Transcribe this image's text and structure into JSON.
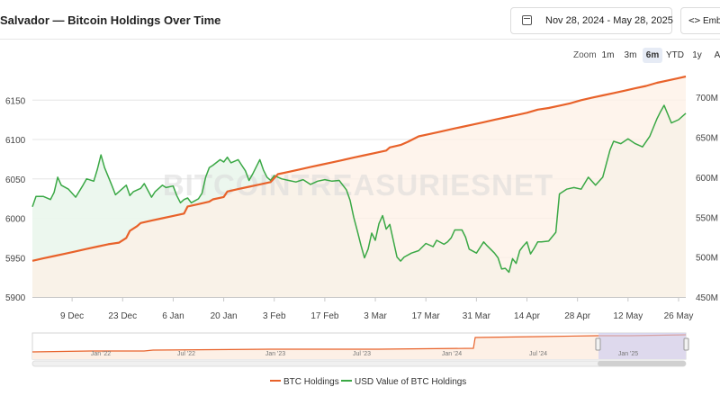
{
  "header": {
    "title": "Salvador — Bitcoin Holdings Over Time",
    "date_range": "Nov 28, 2024 - May 28, 2025",
    "embed_label": "Embe"
  },
  "zoom": {
    "label": "Zoom",
    "options": [
      "1m",
      "3m",
      "6m",
      "YTD",
      "1y",
      "A"
    ],
    "active": "6m"
  },
  "watermark": "BITCOINTREASURIESNET",
  "colors": {
    "btc": "#e8622a",
    "usd": "#3aa845",
    "btc_fill": "#fdf0e6",
    "usd_fill": "#eaf6ec",
    "navigator_mask": "#c9c9f2"
  },
  "chart_data": {
    "type": "line",
    "title": "",
    "x_range": [
      "2024-11-28",
      "2025-05-28"
    ],
    "x_ticks": [
      "9 Dec",
      "23 Dec",
      "6 Jan",
      "20 Jan",
      "3 Feb",
      "17 Feb",
      "3 Mar",
      "17 Mar",
      "31 Mar",
      "14 Apr",
      "28 Apr",
      "12 May",
      "26 May"
    ],
    "y_left": {
      "ticks": [
        "5900",
        "5950",
        "6000",
        "6050",
        "6100",
        "6150"
      ],
      "range": [
        5900,
        6188
      ]
    },
    "y_right": {
      "ticks": [
        "450M",
        "500M",
        "550M",
        "600M",
        "650M",
        "700M"
      ],
      "range": [
        450,
        734
      ]
    },
    "series": [
      {
        "name": "BTC Holdings",
        "axis": "left",
        "points": [
          [
            "2024-11-28",
            5946
          ],
          [
            "2024-12-01",
            5949
          ],
          [
            "2024-12-04",
            5952
          ],
          [
            "2024-12-07",
            5955
          ],
          [
            "2024-12-10",
            5958
          ],
          [
            "2024-12-13",
            5961
          ],
          [
            "2024-12-16",
            5964
          ],
          [
            "2024-12-19",
            5967
          ],
          [
            "2024-12-22",
            5969
          ],
          [
            "2024-12-24",
            5975
          ],
          [
            "2024-12-25",
            5984
          ],
          [
            "2024-12-27",
            5990
          ],
          [
            "2024-12-28",
            5994
          ],
          [
            "2024-12-31",
            5997
          ],
          [
            "2025-01-03",
            6000
          ],
          [
            "2025-01-06",
            6003
          ],
          [
            "2025-01-09",
            6006
          ],
          [
            "2025-01-10",
            6015
          ],
          [
            "2025-01-13",
            6018
          ],
          [
            "2025-01-16",
            6021
          ],
          [
            "2025-01-17",
            6024
          ],
          [
            "2025-01-20",
            6027
          ],
          [
            "2025-01-21",
            6034
          ],
          [
            "2025-01-24",
            6037
          ],
          [
            "2025-01-27",
            6040
          ],
          [
            "2025-01-30",
            6043
          ],
          [
            "2025-02-02",
            6046
          ],
          [
            "2025-02-04",
            6056
          ],
          [
            "2025-02-07",
            6059
          ],
          [
            "2025-02-10",
            6062
          ],
          [
            "2025-02-13",
            6065
          ],
          [
            "2025-02-16",
            6068
          ],
          [
            "2025-02-19",
            6071
          ],
          [
            "2025-02-22",
            6074
          ],
          [
            "2025-02-25",
            6077
          ],
          [
            "2025-02-28",
            6080
          ],
          [
            "2025-03-03",
            6083
          ],
          [
            "2025-03-06",
            6086
          ],
          [
            "2025-03-07",
            6090
          ],
          [
            "2025-03-10",
            6093
          ],
          [
            "2025-03-12",
            6097
          ],
          [
            "2025-03-15",
            6104
          ],
          [
            "2025-03-18",
            6107
          ],
          [
            "2025-03-21",
            6110
          ],
          [
            "2025-03-24",
            6113
          ],
          [
            "2025-03-27",
            6116
          ],
          [
            "2025-03-30",
            6119
          ],
          [
            "2025-04-02",
            6122
          ],
          [
            "2025-04-05",
            6125
          ],
          [
            "2025-04-08",
            6128
          ],
          [
            "2025-04-11",
            6131
          ],
          [
            "2025-04-14",
            6134
          ],
          [
            "2025-04-17",
            6138
          ],
          [
            "2025-04-20",
            6140
          ],
          [
            "2025-04-23",
            6143
          ],
          [
            "2025-04-26",
            6146
          ],
          [
            "2025-04-29",
            6150
          ],
          [
            "2025-05-02",
            6153
          ],
          [
            "2025-05-05",
            6156
          ],
          [
            "2025-05-08",
            6159
          ],
          [
            "2025-05-11",
            6162
          ],
          [
            "2025-05-14",
            6165
          ],
          [
            "2025-05-17",
            6168
          ],
          [
            "2025-05-20",
            6172
          ],
          [
            "2025-05-23",
            6175
          ],
          [
            "2025-05-26",
            6178
          ],
          [
            "2025-05-28",
            6180
          ]
        ]
      },
      {
        "name": "USD Value of BTC Holdings",
        "axis": "right",
        "points": [
          [
            "2024-11-28",
            563
          ],
          [
            "2024-11-29",
            576
          ],
          [
            "2024-12-01",
            576
          ],
          [
            "2024-12-03",
            572
          ],
          [
            "2024-12-04",
            581
          ],
          [
            "2024-12-05",
            600
          ],
          [
            "2024-12-06",
            590
          ],
          [
            "2024-12-08",
            585
          ],
          [
            "2024-12-10",
            575
          ],
          [
            "2024-12-12",
            590
          ],
          [
            "2024-12-13",
            598
          ],
          [
            "2024-12-15",
            595
          ],
          [
            "2024-12-16",
            610
          ],
          [
            "2024-12-17",
            628
          ],
          [
            "2024-12-18",
            612
          ],
          [
            "2024-12-20",
            590
          ],
          [
            "2024-12-21",
            578
          ],
          [
            "2024-12-23",
            586
          ],
          [
            "2024-12-24",
            590
          ],
          [
            "2024-12-25",
            577
          ],
          [
            "2024-12-26",
            582
          ],
          [
            "2024-12-28",
            586
          ],
          [
            "2024-12-29",
            592
          ],
          [
            "2024-12-31",
            575
          ],
          [
            "2025-01-01",
            582
          ],
          [
            "2025-01-03",
            590
          ],
          [
            "2025-01-04",
            587
          ],
          [
            "2025-01-06",
            589
          ],
          [
            "2025-01-07",
            577
          ],
          [
            "2025-01-08",
            568
          ],
          [
            "2025-01-09",
            572
          ],
          [
            "2025-01-10",
            574
          ],
          [
            "2025-01-11",
            568
          ],
          [
            "2025-01-13",
            573
          ],
          [
            "2025-01-14",
            580
          ],
          [
            "2025-01-15",
            600
          ],
          [
            "2025-01-16",
            612
          ],
          [
            "2025-01-17",
            615
          ],
          [
            "2025-01-19",
            622
          ],
          [
            "2025-01-20",
            619
          ],
          [
            "2025-01-21",
            625
          ],
          [
            "2025-01-22",
            618
          ],
          [
            "2025-01-23",
            620
          ],
          [
            "2025-01-24",
            622
          ],
          [
            "2025-01-25",
            615
          ],
          [
            "2025-01-26",
            608
          ],
          [
            "2025-01-27",
            596
          ],
          [
            "2025-01-28",
            604
          ],
          [
            "2025-01-30",
            622
          ],
          [
            "2025-01-31",
            609
          ],
          [
            "2025-02-01",
            600
          ],
          [
            "2025-02-02",
            596
          ],
          [
            "2025-02-03",
            602
          ],
          [
            "2025-02-05",
            598
          ],
          [
            "2025-02-07",
            596
          ],
          [
            "2025-02-09",
            594
          ],
          [
            "2025-02-11",
            597
          ],
          [
            "2025-02-13",
            591
          ],
          [
            "2025-02-15",
            595
          ],
          [
            "2025-02-17",
            597
          ],
          [
            "2025-02-19",
            595
          ],
          [
            "2025-02-21",
            596
          ],
          [
            "2025-02-23",
            584
          ],
          [
            "2025-02-24",
            571
          ],
          [
            "2025-02-25",
            550
          ],
          [
            "2025-02-26",
            533
          ],
          [
            "2025-02-27",
            515
          ],
          [
            "2025-02-28",
            499
          ],
          [
            "2025-03-01",
            510
          ],
          [
            "2025-03-02",
            530
          ],
          [
            "2025-03-03",
            521
          ],
          [
            "2025-03-04",
            542
          ],
          [
            "2025-03-05",
            552
          ],
          [
            "2025-03-06",
            535
          ],
          [
            "2025-03-07",
            541
          ],
          [
            "2025-03-09",
            500
          ],
          [
            "2025-03-10",
            495
          ],
          [
            "2025-03-11",
            500
          ],
          [
            "2025-03-13",
            505
          ],
          [
            "2025-03-15",
            508
          ],
          [
            "2025-03-17",
            517
          ],
          [
            "2025-03-19",
            513
          ],
          [
            "2025-03-20",
            521
          ],
          [
            "2025-03-22",
            516
          ],
          [
            "2025-03-23",
            519
          ],
          [
            "2025-03-24",
            524
          ],
          [
            "2025-03-25",
            534
          ],
          [
            "2025-03-27",
            534
          ],
          [
            "2025-03-28",
            525
          ],
          [
            "2025-03-29",
            510
          ],
          [
            "2025-03-31",
            505
          ],
          [
            "2025-04-01",
            512
          ],
          [
            "2025-04-02",
            519
          ],
          [
            "2025-04-03",
            514
          ],
          [
            "2025-04-05",
            505
          ],
          [
            "2025-04-06",
            499
          ],
          [
            "2025-04-07",
            485
          ],
          [
            "2025-04-08",
            486
          ],
          [
            "2025-04-09",
            481
          ],
          [
            "2025-04-10",
            498
          ],
          [
            "2025-04-11",
            492
          ],
          [
            "2025-04-12",
            508
          ],
          [
            "2025-04-13",
            514
          ],
          [
            "2025-04-14",
            519
          ],
          [
            "2025-04-15",
            504
          ],
          [
            "2025-04-16",
            511
          ],
          [
            "2025-04-17",
            519
          ],
          [
            "2025-04-18",
            519
          ],
          [
            "2025-04-20",
            520
          ],
          [
            "2025-04-22",
            531
          ],
          [
            "2025-04-23",
            579
          ],
          [
            "2025-04-25",
            585
          ],
          [
            "2025-04-27",
            587
          ],
          [
            "2025-04-29",
            585
          ],
          [
            "2025-05-01",
            600
          ],
          [
            "2025-05-03",
            590
          ],
          [
            "2025-05-05",
            600
          ],
          [
            "2025-05-07",
            634
          ],
          [
            "2025-05-08",
            645
          ],
          [
            "2025-05-10",
            642
          ],
          [
            "2025-05-12",
            648
          ],
          [
            "2025-05-14",
            642
          ],
          [
            "2025-05-16",
            638
          ],
          [
            "2025-05-18",
            651
          ],
          [
            "2025-05-20",
            673
          ],
          [
            "2025-05-21",
            682
          ],
          [
            "2025-05-22",
            690
          ],
          [
            "2025-05-24",
            668
          ],
          [
            "2025-05-26",
            672
          ],
          [
            "2025-05-28",
            680
          ]
        ]
      }
    ],
    "legend": [
      "BTC Holdings",
      "USD Value of BTC Holdings"
    ],
    "legend_position": "bottom",
    "grid": true
  },
  "navigator": {
    "ticks": [
      "Jan '22",
      "Jul '22",
      "Jan '23",
      "Jul '23",
      "Jan '24",
      "Jul '24",
      "Jan '25"
    ]
  }
}
